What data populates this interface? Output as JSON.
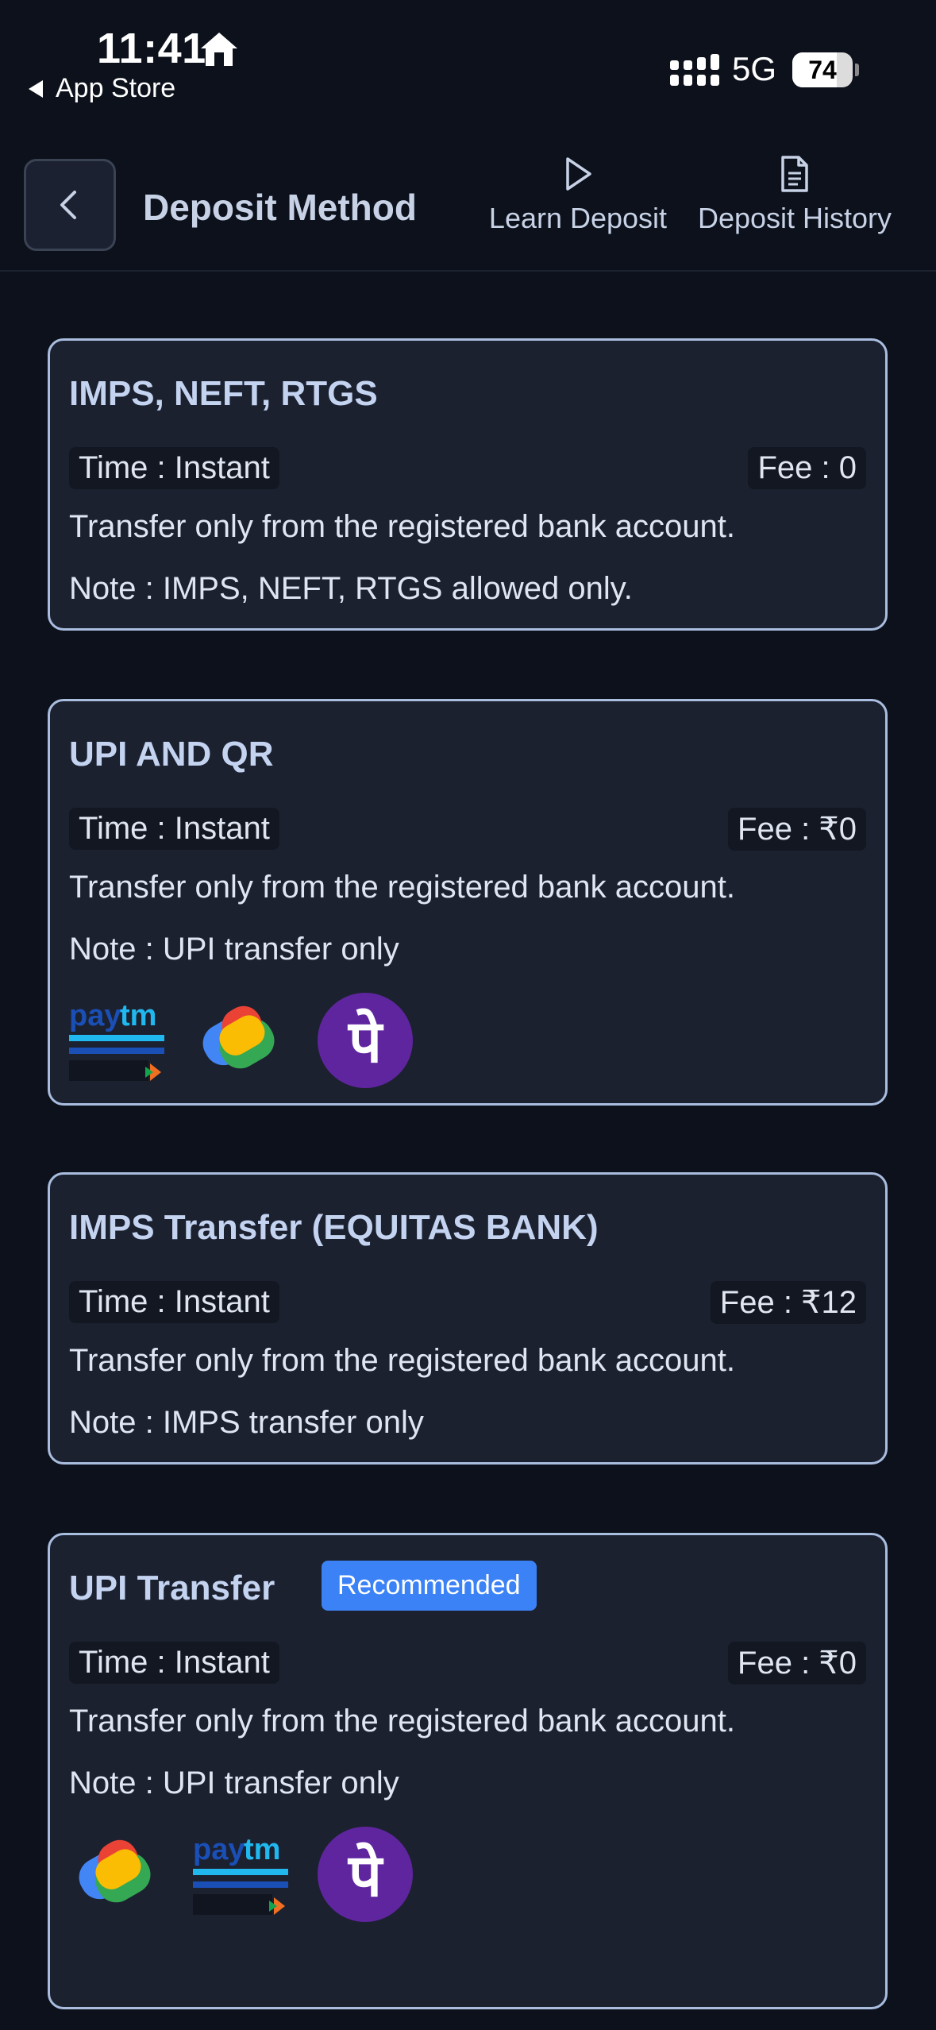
{
  "status_bar": {
    "time": "11:41",
    "back_app": "App Store",
    "network": "5G",
    "battery": "74"
  },
  "header": {
    "title": "Deposit Method",
    "learn_deposit": "Learn Deposit",
    "deposit_history": "Deposit History"
  },
  "methods": [
    {
      "title": "IMPS, NEFT, RTGS",
      "time": "Time : Instant",
      "fee": "Fee : 0",
      "desc": "Transfer only from the registered bank account.",
      "note": "Note : IMPS, NEFT, RTGS allowed only."
    },
    {
      "title": "UPI AND QR",
      "time": "Time : Instant",
      "fee": "Fee : ₹0",
      "desc": "Transfer only from the registered bank account.",
      "note": "Note : UPI transfer only",
      "logos": [
        "paytm-logo",
        "google-pay-logo",
        "phonepe-logo"
      ]
    },
    {
      "title": "IMPS Transfer (EQUITAS BANK)",
      "time": "Time : Instant",
      "fee": "Fee : ₹12",
      "desc": "Transfer only from the registered bank account.",
      "note": "Note : IMPS transfer only"
    },
    {
      "title": "UPI Transfer",
      "badge": "Recommended",
      "time": "Time : Instant",
      "fee": "Fee : ₹0",
      "desc": "Transfer only from the registered bank account.",
      "note": "Note : UPI transfer only",
      "logos": [
        "google-pay-logo",
        "paytm-logo",
        "phonepe-logo"
      ]
    }
  ],
  "colors": {
    "background": "#0c111b",
    "card": "#1c2130",
    "card_border": "#a9bddf",
    "badge": "#3b82f6",
    "phonepe": "#5f259f"
  }
}
